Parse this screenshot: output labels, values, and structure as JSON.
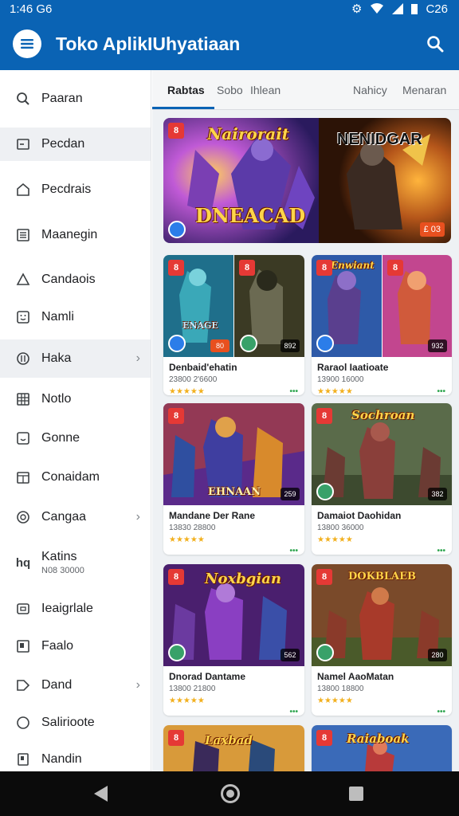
{
  "status": {
    "time": "1:46",
    "time_suffix": "G6",
    "right_text": "C26"
  },
  "appbar": {
    "title": "Toko AplikIUhyatiaan"
  },
  "sidebar": {
    "items": [
      {
        "label": "Paaran",
        "icon": "search-icon"
      },
      {
        "label": "Pecdan",
        "icon": "square-icon"
      },
      {
        "label": "Pecdrais",
        "icon": "home-icon"
      },
      {
        "label": "Maanegin",
        "icon": "list-icon"
      },
      {
        "label": "Candaois",
        "icon": "triangle-icon"
      },
      {
        "label": "Namli",
        "icon": "emoji-icon"
      },
      {
        "label": "Haka",
        "icon": "circle-icon"
      },
      {
        "label": "Notlo",
        "icon": "grid-icon"
      },
      {
        "label": "Gonne",
        "icon": "smile-icon"
      },
      {
        "label": "Conaidam",
        "icon": "calendar-icon"
      },
      {
        "label": "Cangaa",
        "icon": "ring-icon"
      },
      {
        "label": "Katins",
        "sub": "N08 30000",
        "icon": "hq-icon"
      },
      {
        "label": "Ieaigrlale",
        "icon": "box-icon"
      },
      {
        "label": "Faalo",
        "icon": "frame-icon"
      },
      {
        "label": "Dand",
        "icon": "tag-icon"
      },
      {
        "label": "Salirioote",
        "icon": "circle-outline-icon"
      },
      {
        "label": "Nandin",
        "icon": "doc-icon"
      }
    ]
  },
  "tabs": {
    "t1": "Rabtas",
    "t2": "Sobo",
    "t3": "Ihlean",
    "t4": "Nahicy",
    "t5": "Menaran"
  },
  "banner": {
    "left_text": "DNEACAD",
    "left_sub": "Nairorait",
    "right_text": "NENIDGAR",
    "badge": "8",
    "price": "£ 03"
  },
  "cards": [
    {
      "title": "Denbaid'ehatin",
      "meta": "23800 2'6600",
      "corner1": "80",
      "corner2": "892",
      "badge": "8",
      "art": "ENAGE"
    },
    {
      "title": "Raraol Iaatioate",
      "meta": "13900 16000",
      "corner1": "",
      "corner2": "932",
      "badge": "8",
      "art": "Enwiant"
    },
    {
      "title": "Mandane Der Rane",
      "meta": "13830 28800",
      "corner1": "",
      "corner2": "259",
      "badge": "8",
      "art": "EHNAAN"
    },
    {
      "title": "Damaiot Daohidan",
      "meta": "13800 36000",
      "corner1": "",
      "corner2": "382",
      "badge": "8",
      "art": "Sochroan"
    },
    {
      "title": "Dnorad Dantame",
      "meta": "13800 21800",
      "corner1": "",
      "corner2": "562",
      "badge": "8",
      "art": "Noxbgian"
    },
    {
      "title": "Namel AaoMatan",
      "meta": "13800 18800",
      "corner1": "",
      "corner2": "280",
      "badge": "8",
      "art": "DOKBLAEB"
    },
    {
      "title": "",
      "meta": "",
      "corner1": "",
      "corner2": "",
      "badge": "8",
      "art": "Laxbad"
    },
    {
      "title": "",
      "meta": "",
      "corner1": "",
      "corner2": "",
      "badge": "8",
      "art": "Raiaboak"
    }
  ],
  "ratings": {
    "stars": "★★★★★",
    "dots": "•••"
  },
  "colors": {
    "primary": "#0a63b4",
    "star": "#f2b01e",
    "badge_red": "#e53935",
    "dots_green": "#34a853"
  }
}
